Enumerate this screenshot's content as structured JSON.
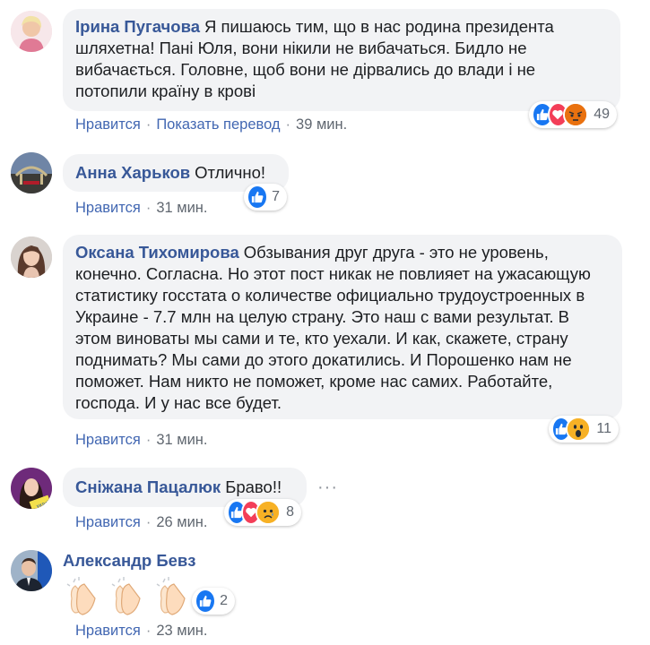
{
  "actions": {
    "like_label": "Нравится",
    "translate_label": "Показать перевод",
    "separator": "·"
  },
  "colors": {
    "author": "#385898",
    "like": "#1877f2",
    "love": "#f33e58",
    "emoji": "#f7b125",
    "bubble": "#f2f3f5"
  },
  "comments": [
    {
      "author": "Ірина Пугачова",
      "text": "Я пишаюсь тим, що в нас родина президента шляхетна! Пані Юля, вони нікили не вибачаться. Бидло не вибачається. Головне, щоб вони не дірвались до влади і не потопили країну в крові",
      "time": "39 мин.",
      "reaction_count": "49",
      "reactions": [
        "like",
        "love",
        "angry"
      ]
    },
    {
      "author": "Анна Харьков",
      "text": "Отлично!",
      "time": "31 мин.",
      "reaction_count": "7",
      "reactions": [
        "like"
      ]
    },
    {
      "author": "Оксана Тихомирова",
      "text": "Обзывания друг друга - это не уровень, конечно. Согласна. Но этот пост никак не повлияет на ужасающую статистику госстата о количестве официально трудоустроенных в Украине - 7.7 млн на целую страну. Это наш с вами результат. В этом виноваты мы сами и те, кто уехали. И как, скажете, страну поднимать? Мы сами до этого докатились. И Порошенко нам не поможет. Нам никто не поможет, кроме нас самих. Работайте, господа. И у нас все будет.",
      "time": "31 мин.",
      "reaction_count": "11",
      "reactions": [
        "like",
        "wow"
      ]
    },
    {
      "author": "Сніжана Пацалюк",
      "text": "Браво!!",
      "time": "26 мин.",
      "reaction_count": "8",
      "reactions": [
        "like",
        "love",
        "sad"
      ],
      "more_icon": "more-dots-icon"
    },
    {
      "author": "Александр Бевз",
      "text": "",
      "time": "23 мин.",
      "reaction_count": "2",
      "reactions": [
        "like"
      ],
      "stickers": [
        "clapping-hands",
        "clapping-hands",
        "clapping-hands"
      ]
    }
  ]
}
